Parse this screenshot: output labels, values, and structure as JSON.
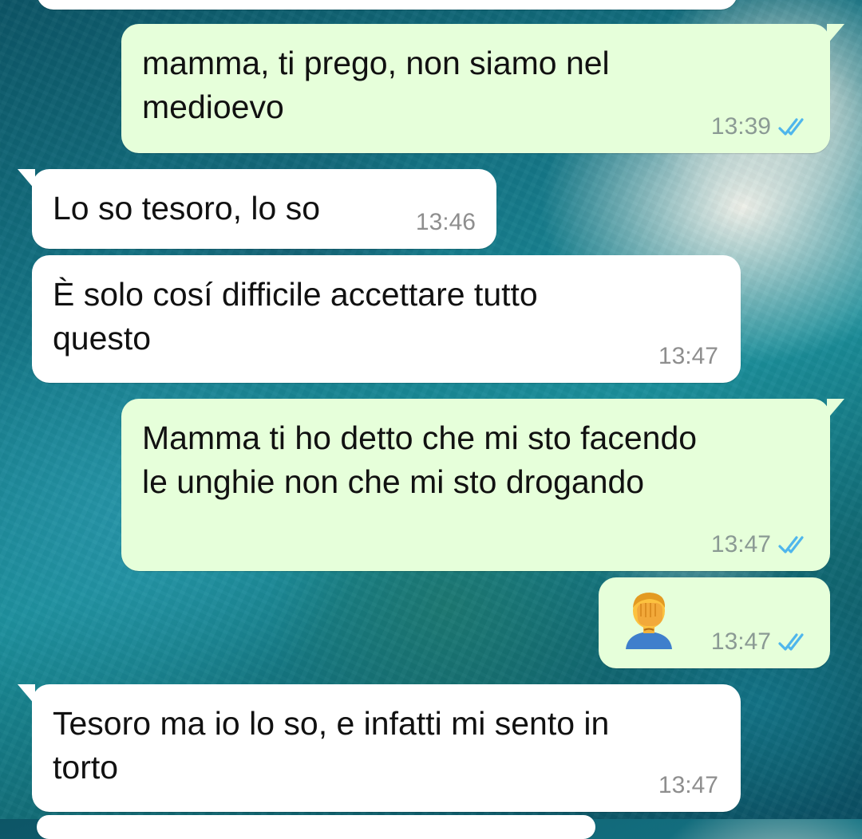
{
  "messages": [
    {
      "direction": "outgoing",
      "text": "mamma, ti prego, non siamo nel\nmedioevo",
      "time": "13:39",
      "status": "read"
    },
    {
      "direction": "incoming",
      "text": "Lo so tesoro, lo so",
      "time": "13:46"
    },
    {
      "direction": "incoming",
      "text": "È solo cosí difficile accettare tutto\nquesto",
      "time": "13:47"
    },
    {
      "direction": "outgoing",
      "text": "Mamma ti ho detto che mi sto facendo\nle unghie non che mi sto drogando",
      "time": "13:47",
      "status": "read"
    },
    {
      "direction": "outgoing",
      "emoji": "man-facepalming",
      "time": "13:47",
      "status": "read"
    },
    {
      "direction": "incoming",
      "text": "Tesoro ma io lo so, e infatti mi sento in\ntorto",
      "time": "13:47"
    }
  ],
  "colors": {
    "outgoing_bubble": "#e6ffda",
    "incoming_bubble": "#ffffff",
    "read_ticks": "#4fb6ec",
    "timestamp": "#8b9a94"
  }
}
